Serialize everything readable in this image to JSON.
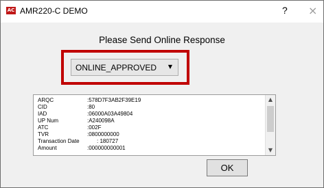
{
  "window": {
    "title": "AMR220-C DEMO",
    "app_icon_text": "AC",
    "help_label": "?",
    "close_label": "×"
  },
  "prompt": "Please Send Online Response",
  "dropdown": {
    "selected": "ONLINE_APPROVED"
  },
  "fields": [
    {
      "label": "ARQC",
      "value": ":578D7F3AB2F39E19"
    },
    {
      "label": "CID",
      "value": ":80"
    },
    {
      "label": "IAD",
      "value": ":06000A03A49804"
    },
    {
      "label": "UP Num",
      "value": ":A240098A"
    },
    {
      "label": "ATC",
      "value": ":002F"
    },
    {
      "label": "TVR",
      "value": ":0800000000"
    },
    {
      "label": "Transaction Date",
      "value": ": 180727"
    },
    {
      "label": "Amount",
      "value": ":000000000001"
    }
  ],
  "ok_label": "OK",
  "colors": {
    "highlight_border": "#c00000",
    "dialog_bg": "#f0f0f0"
  }
}
